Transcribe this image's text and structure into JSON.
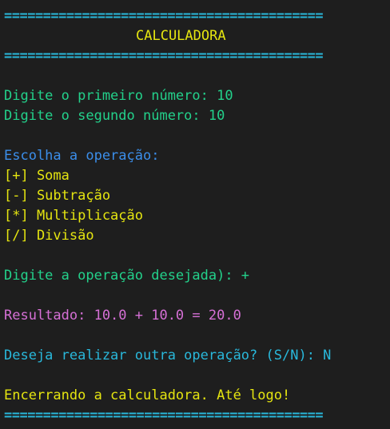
{
  "colors": {
    "background": "#1e1e1e",
    "rule": "#29b8db",
    "title": "#e5e510",
    "input_prompt": "#23d18b",
    "menu_header": "#3b8eea",
    "menu_item": "#e5e510",
    "result": "#d670d6",
    "continue_prompt": "#29b8db",
    "farewell": "#e5e510"
  },
  "rule": "=========================================",
  "title": "CALCULADORA",
  "inputs": {
    "first_number": "Digite o primeiro número: 10",
    "second_number": "Digite o segundo número: 10"
  },
  "menu": {
    "header": "Escolha a operação:",
    "items": [
      {
        "label": "[+] Soma"
      },
      {
        "label": "[-] Subtração"
      },
      {
        "label": "[*] Multiplicação"
      },
      {
        "label": "[/] Divisão"
      }
    ]
  },
  "operation_prompt": "Digite a operação desejada): +",
  "result": "Resultado: 10.0 + 10.0 = 20.0",
  "continue_prompt": "Deseja realizar outra operação? (S/N): N",
  "farewell": "Encerrando a calculadora. Até logo!"
}
